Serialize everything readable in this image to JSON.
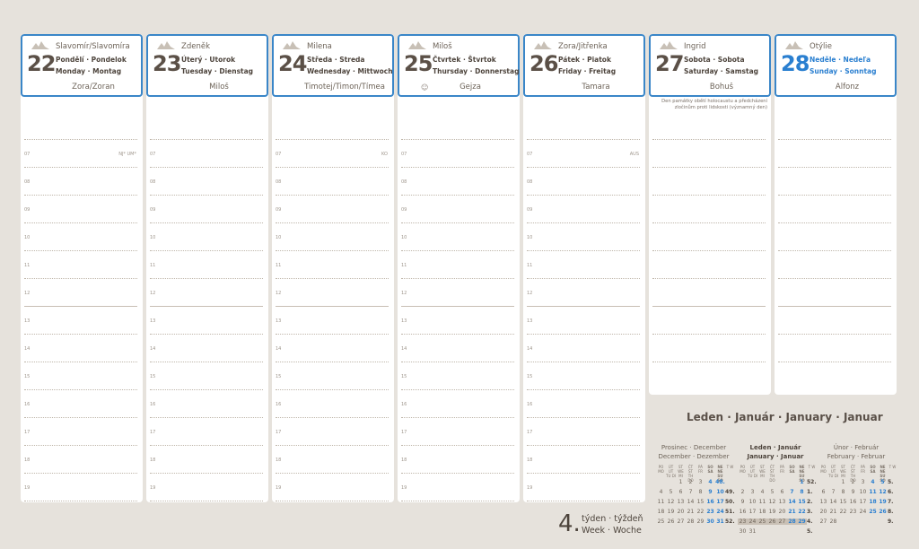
{
  "days": [
    {
      "num": "22",
      "name1": "Slavomír/Slavomíra",
      "d1": "Pondělí · Pondelok",
      "d2": "Monday · Montag",
      "name2": "Zora/Zoran",
      "tag": "NJ* UM*",
      "sunday": false
    },
    {
      "num": "23",
      "name1": "Zdeněk",
      "d1": "Úterý · Utorok",
      "d2": "Tuesday · Dienstag",
      "name2": "Miloš",
      "tag": "",
      "sunday": false
    },
    {
      "num": "24",
      "name1": "Milena",
      "d1": "Středa · Streda",
      "d2": "Wednesday · Mittwoch",
      "name2": "Timotej/Timon/Tímea",
      "tag": "KO",
      "sunday": false
    },
    {
      "num": "25",
      "name1": "Miloš",
      "d1": "Čtvrtek · Štvrtok",
      "d2": "Thursday · Donnerstag",
      "name2": "Gejza",
      "tag": "",
      "sunday": false
    },
    {
      "num": "26",
      "name1": "Zora/Jitřenka",
      "d1": "Pátek · Piatok",
      "d2": "Friday · Freitag",
      "name2": "Tamara",
      "tag": "AUS",
      "sunday": false
    },
    {
      "num": "27",
      "name1": "Ingrid",
      "d1": "Sobota · Sobota",
      "d2": "Saturday · Samstag",
      "name2": "Bohuš",
      "tag": "",
      "sunday": false,
      "note": "Den památky obětí holocaustu a předcházení zločinům proti lidskosti (významný den)"
    },
    {
      "num": "28",
      "name1": "Otýlie",
      "d1": "Neděle · Nedeľa",
      "d2": "Sunday · Sonntag",
      "name2": "Alfonz",
      "tag": "",
      "sunday": true
    }
  ],
  "smile_glyph": "☺",
  "hours": [
    "07",
    "08",
    "09",
    "10",
    "11",
    "12",
    "13",
    "14",
    "15",
    "16",
    "17",
    "18",
    "19"
  ],
  "week": {
    "number": "4.",
    "label1": "týden · týždeň",
    "label2": "Week · Woche"
  },
  "calendar": {
    "title": "Leden · Január · January · Januar",
    "day_headers": [
      "PO MO",
      "ÚT UT TU DI",
      "ST WE MI",
      "ČT ŠT TH DO",
      "PÁ FR",
      "SO SA",
      "NE NE SU SO",
      "T W"
    ],
    "months": [
      {
        "title1": "Prosinec · December",
        "title2": "December · Dezember",
        "bold": false,
        "rows": [
          [
            "",
            "",
            "1",
            "2",
            "3",
            "4",
            "48."
          ],
          [
            "4",
            "5",
            "6",
            "7",
            "8",
            "9",
            "10",
            "49."
          ],
          [
            "11",
            "12",
            "13",
            "14",
            "15",
            "16",
            "17",
            "50."
          ],
          [
            "18",
            "19",
            "20",
            "21",
            "22",
            "23",
            "24",
            "51."
          ],
          [
            "25",
            "26",
            "27",
            "28",
            "29",
            "30",
            "31",
            "52."
          ]
        ]
      },
      {
        "title1": "Leden · Január",
        "title2": "January · Januar",
        "bold": true,
        "rows": [
          [
            "",
            "",
            "",
            "",
            "",
            "",
            "1",
            "52."
          ],
          [
            "2",
            "3",
            "4",
            "5",
            "6",
            "7",
            "8",
            "1."
          ],
          [
            "9",
            "10",
            "11",
            "12",
            "13",
            "14",
            "15",
            "2."
          ],
          [
            "16",
            "17",
            "18",
            "19",
            "20",
            "21",
            "22",
            "3."
          ],
          [
            "23",
            "24",
            "25",
            "26",
            "27",
            "28",
            "29",
            "4."
          ],
          [
            "30",
            "31",
            "",
            "",
            "",
            "",
            "",
            "5."
          ]
        ]
      },
      {
        "title1": "Únor · Február",
        "title2": "February · Februar",
        "bold": false,
        "rows": [
          [
            "",
            "",
            "1",
            "2",
            "3",
            "4",
            "5",
            "5."
          ],
          [
            "6",
            "7",
            "8",
            "9",
            "10",
            "11",
            "12",
            "6."
          ],
          [
            "13",
            "14",
            "15",
            "16",
            "17",
            "18",
            "19",
            "7."
          ],
          [
            "20",
            "21",
            "22",
            "23",
            "24",
            "25",
            "26",
            "8."
          ],
          [
            "27",
            "28",
            "",
            "",
            "",
            "",
            "",
            "9."
          ]
        ]
      }
    ]
  },
  "colors": {
    "accent": "#3a86c8",
    "sunday": "#2a7fd0",
    "text": "#5a5048",
    "background": "#e6e2dc"
  }
}
